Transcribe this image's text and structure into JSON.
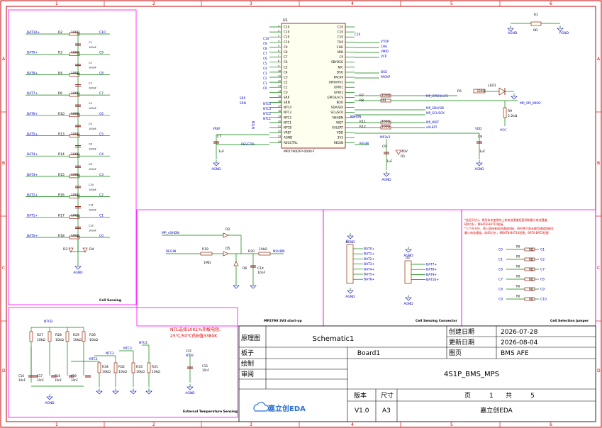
{
  "frame": {
    "cols": [
      "1",
      "2",
      "3",
      "4",
      "5",
      "6"
    ],
    "rows": [
      "A",
      "B",
      "C",
      "D"
    ]
  },
  "cell_sensing": {
    "title": "Cell Sensing",
    "bat_labels": [
      "BAT10+",
      "BAT9+",
      "BAT8+",
      "BAT7+",
      "BAT6+",
      "BAT5+",
      "BAT4+",
      "BAT3+",
      "BAT2+",
      "BAT1+",
      "BAT0+"
    ],
    "res_refs": [
      "R2",
      "R3",
      "R4",
      "R6",
      "R10",
      "R13",
      "R14",
      "R15",
      "R16",
      "R17",
      "R18"
    ],
    "res_value": "100Ω",
    "c_nets": [
      "C10",
      "C9",
      "C8",
      "C7",
      "C6",
      "C5",
      "C4",
      "C3",
      "C2",
      "C1",
      "C0"
    ],
    "cap_refs": [
      "C1",
      "C2",
      "C3",
      "C4",
      "C5",
      "C6",
      "C8",
      "C10",
      "C11",
      "C12",
      "C13"
    ],
    "cap_value": "100nF",
    "diodes": [
      "D3",
      "D4"
    ],
    "gnd": "AGND"
  },
  "ic": {
    "ref": "U1",
    "part": "MP2790DFP-0000-T",
    "left_pins": [
      "C10",
      "C10",
      "C10",
      "C10",
      "C9",
      "C8",
      "C7",
      "C6",
      "C5",
      "C4",
      "C3",
      "C2",
      "C1",
      "C0",
      "SRP",
      "SRN",
      "NTC4",
      "NTC3",
      "NTC2",
      "NTC1",
      "NTCB",
      "VREF",
      "AGND",
      "REGCTRL"
    ],
    "right_pins": [
      "C10",
      "C10",
      "C10",
      "TOP",
      "CHG",
      "MID",
      "CP",
      "SBYDSG",
      "N/C",
      "DSG",
      "PACKP",
      "GPIO/HV1",
      "GPIO1",
      "GPIO2",
      "GPIO3/nCS",
      "BOO",
      "SDA/SDI",
      "SCL/SCK",
      "NSHDN",
      "WDT",
      "XALERT",
      "VDD",
      "3V3",
      "REGIN"
    ],
    "left_nets": [
      "C10",
      "C9",
      "C8",
      "C7",
      "C6",
      "C5",
      "C4",
      "C3",
      "C2",
      "C1",
      "C0",
      "SRP",
      "SRN",
      "NTC4",
      "NTC3",
      "NTC2",
      "NTC1",
      "NTCB",
      "VREF",
      "REGCTRL"
    ],
    "right_nets": [
      "C10",
      "VTOP",
      "CHG",
      "VMID",
      "VCP",
      "DSG",
      "PACKP",
      "MP_GPIO3/nCS",
      "MP_SDA/SDI",
      "MP_SCL/SCK",
      "NSHDN",
      "MP_WDT",
      "xALERT",
      "VDD",
      "MP3V3",
      "REGIN"
    ],
    "r7": [
      "R7",
      "100Ω"
    ],
    "r8": [
      "R8",
      "0Ω"
    ],
    "r11": [
      "R11",
      "100Ω"
    ],
    "r12": [
      "R12",
      "100Ω"
    ],
    "c7": [
      "C7",
      "1uF"
    ],
    "c8": [
      "C8",
      "1uF"
    ],
    "c9": [
      "C9",
      "1uF"
    ],
    "d1": [
      "D1",
      "40V"
    ],
    "r5": [
      "R5",
      "330Ω"
    ],
    "led1": "LED1",
    "r9": [
      "R9",
      "2.2kΩ"
    ],
    "r1": [
      "R1",
      "0Ω"
    ],
    "vcc": "VCC",
    "spi_miso": "MP_SPI_MISO",
    "agnd": "AGND",
    "pgnd": "PGND"
  },
  "startup": {
    "title": "MP2790 3V3 start-up",
    "d2": "D2",
    "d5": "D5",
    "d6": "D6",
    "r19": [
      "R19",
      "1MΩ"
    ],
    "r20": [
      "R20",
      "10kΩ"
    ],
    "c14": [
      "C14",
      "10nF"
    ],
    "nets": [
      "MP_nSHDN",
      "REGIN",
      "NSHDN"
    ]
  },
  "connector": {
    "title": "Cell Sensing Connector",
    "j1": "J1",
    "j2": "U2",
    "j1_nets": [
      "BAT0+",
      "BAT1+",
      "BAT2+",
      "BAT3+",
      "BAT4+",
      "BAT5+",
      "BAT6+"
    ],
    "j2_nets": [
      "BAT7+",
      "BAT8+",
      "BAT9+",
      "BAT10+"
    ]
  },
  "jumper": {
    "title": "Cell Selection Jumper",
    "note1": "*此区0方针，将所有未使用的上和电池通道短接到和最大电池通道,",
    "note2": "BJ0方针，将BAT8-BAT10短接",
    "note3": "*三个中方针，将上面所有电池通道短接，四时将下面未使用通道短接至",
    "note4": "最小电池通道，如4S方针，将BAT8-BAT10短接，BAT0-BAT2短接",
    "rows": [
      {
        "l": "C0",
        "r": "C1",
        "res": "R0"
      },
      {
        "l": "C1",
        "r": "C2",
        "res": "R0"
      },
      {
        "l": "C8",
        "r": "C7",
        "res": "R0"
      },
      {
        "l": "C7",
        "r": "C6",
        "res": "R0"
      },
      {
        "l": "C8",
        "r": "C9",
        "res": "R0"
      },
      {
        "l": "C9",
        "r": "C10",
        "res": "R0"
      }
    ],
    "res_value": "0Ω"
  },
  "ext_temp": {
    "title": "External Temperature Sensing",
    "note_line1": "NTC选择10K1%热敏电阻,",
    "note_line2": "25℃/50℃的B值3380K",
    "res": [
      [
        "R27",
        "10kΩ"
      ],
      [
        "R28",
        "10kΩ"
      ],
      [
        "R29",
        "10kΩ"
      ],
      [
        "R30",
        "10kΩ"
      ]
    ],
    "ntc": [
      "NTCB",
      "NTC1",
      "NTC2",
      "NTC3",
      "NTC4"
    ],
    "rt": [
      [
        "R34",
        "10kΩ"
      ],
      [
        "R32",
        "10kΩ"
      ],
      [
        "R33",
        "10kΩ"
      ],
      [
        "R31",
        "10kΩ"
      ]
    ],
    "caps": [
      [
        "C16",
        "10nF"
      ],
      [
        "C17",
        "10nF"
      ],
      [
        "C18",
        "10nF"
      ],
      [
        "C19",
        "10nF"
      ],
      [
        "C15",
        "10nF"
      ]
    ]
  },
  "title_block": {
    "schematic_label": "原理图",
    "schematic_value": "Schematic1",
    "board_label": "板子",
    "board_value": "Board1",
    "draw_label": "绘制",
    "review_label": "审阅",
    "created_label": "创建日期",
    "created_value": "2026-07-28",
    "updated_label": "更新日期",
    "updated_value": "2026-08-04",
    "page_label": "图页",
    "page_value": "BMS AFE",
    "design_name": "4S1P_BMS_MPS",
    "version_label": "版本",
    "size_label": "尺寸",
    "version_value": "V1.0",
    "size_value": "A3",
    "page_word": "页",
    "page_num": "1",
    "total_word": "共",
    "total_num": "5",
    "company": "嘉立创EDA",
    "logo_text": "嘉立创EDA"
  },
  "colors": {
    "frame": "#c00000",
    "wire": "#008000",
    "net": "#0000c0",
    "part": "#800000",
    "note": "#e00000",
    "panel": "#ff00ff"
  }
}
